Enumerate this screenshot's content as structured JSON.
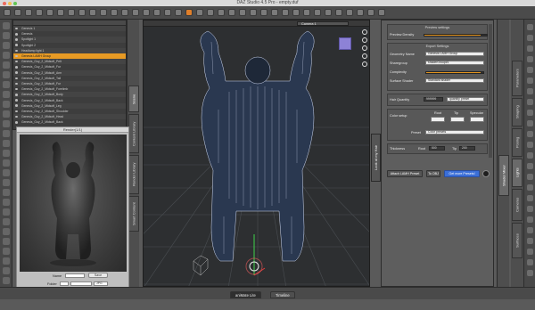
{
  "window": {
    "title": "DAZ Studio 4.5 Pro - empty.duf"
  },
  "scene": {
    "rows": [
      "Genesis 1",
      "Genesis",
      "Spotlight 1",
      "Spotlight 2",
      "Headlamp light 1",
      "Genesis LAMH Group",
      "Genesis_Guy_2_Midsoft_Pelt",
      "Genesis_Guy_2_Midsoft_Fur",
      "Genesis_Guy_2_Midsoft_Arm",
      "Genesis_Guy_2_Midsoft_Tail",
      "Genesis_Guy_2_Midsoft_Fur",
      "Genesis_Guy_2_Midsoft_Forelimb",
      "Genesis_Guy_2_Midsoft_Body",
      "Genesis_Guy_2_Midsoft_Back",
      "Genesis_Guy_2_Midsoft_Leg",
      "Genesis_Guy_2_Midsoft_Shoulder",
      "Genesis_Guy_2_Midsoft_Head",
      "Genesis_Guy_2_Midsoft_Back"
    ],
    "selected_index": 5
  },
  "left_tabs": [
    "Scene",
    "Content Library",
    "Render Library",
    "Smart Content"
  ],
  "render": {
    "title": "Render(1/1)",
    "name_label": "Name",
    "save_label": "Save",
    "folder_label": "Folder",
    "format_label": "JPG",
    "close_label": "Close",
    "cancel_label": "Cancel"
  },
  "viewport": {
    "camera": "Camera 1"
  },
  "bottom_tabs": {
    "animate": "aniMate Lite",
    "timeline": "Timeline"
  },
  "lamh": {
    "tab_label": "Look at my Hair",
    "preview_header": "Preview settings",
    "preview_density_label": "Preview Density",
    "preview_density": 0.9,
    "export_header": "Export Settings",
    "geometry_name_label": "Geometry Name",
    "geometry_name": "Genesis LAMH Group",
    "sharegroup_label": "Sharegroup",
    "sharegroup": "shaderGroup#1",
    "complexity_label": "Complexity",
    "complexity": 0.95,
    "surface_shader_label": "Surface Shader",
    "surface_shader": "Standard shader",
    "hair_quantity_label": "Hair Quantity",
    "hair_quantity": "999999",
    "hair_quantity_mode": "quantity preset",
    "color_setup_label": "Color setup",
    "root_label": "Root",
    "tip_label": "Tip",
    "specular_label": "Specular",
    "preset_label": "Preset",
    "preset": "Color presets",
    "thickness_label": "Thickness",
    "thickness_root_label": "Root",
    "thickness_root": "500",
    "thickness_tip_label": "Tip",
    "thickness_tip": "200",
    "attach_button": "Attach LAMH Preset",
    "to_obj_button": "To OBJ",
    "get_more_button": "Get more Presets!",
    "colors": {
      "accent": "#e6961f",
      "blue_button": "#3b6fd8"
    }
  },
  "right_tabs": [
    "Shader Mixer",
    "Lights",
    "Cameras",
    "Surfaces",
    "Posing",
    "Shaping",
    "Parameters"
  ]
}
